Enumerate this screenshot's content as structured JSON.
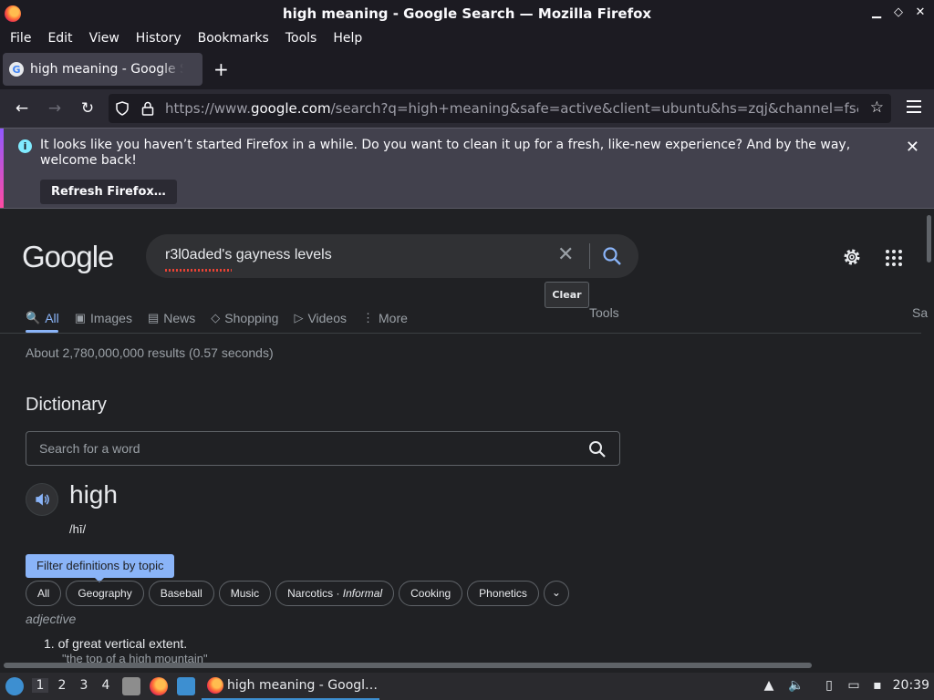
{
  "window": {
    "title": "high meaning - Google Search — Mozilla Firefox",
    "min": "▁",
    "max": "◇",
    "close": "✕"
  },
  "menu": [
    "File",
    "Edit",
    "View",
    "History",
    "Bookmarks",
    "Tools",
    "Help"
  ],
  "tab": {
    "label": "high meaning - Google Search",
    "favicon": "G",
    "close": "✕",
    "new": "+"
  },
  "nav": {
    "url_prefix": "https://www.",
    "url_domain": "google.com",
    "url_rest": "/search?q=high+meaning&safe=active&client=ubuntu&hs=zqj&channel=fs&ei=Ge",
    "star": "☆"
  },
  "notification": {
    "message": "It looks like you haven’t started Firefox in a while. Do you want to clean it up for a fresh, like-new experience? And by the way, welcome back!",
    "button": "Refresh Firefox…",
    "close": "✕",
    "info": "i"
  },
  "google": {
    "logo": "Google",
    "query": "r3l0aded's gayness levels",
    "clear_tooltip": "Clear",
    "tabs": [
      {
        "label": "All",
        "icon": "🔍"
      },
      {
        "label": "Images",
        "icon": "▣"
      },
      {
        "label": "News",
        "icon": "▤"
      },
      {
        "label": "Shopping",
        "icon": "◇"
      },
      {
        "label": "Videos",
        "icon": "▷"
      },
      {
        "label": "More",
        "icon": "⋮"
      }
    ],
    "tools": "Tools",
    "safe": "Sa",
    "stats": "About 2,780,000,000 results (0.57 seconds)"
  },
  "dictionary": {
    "heading": "Dictionary",
    "search_placeholder": "Search for a word",
    "word": "high",
    "phonetic": "/hī/",
    "filter_tip": "Filter definitions by topic",
    "chips": [
      "All",
      "Geography",
      "Baseball",
      "Music",
      "Narcotics",
      "Cooking",
      "Phonetics"
    ],
    "chip_informal": "Informal",
    "part_of_speech": "adjective",
    "definition": "1.  of great vertical extent.",
    "example": "\"the top of a high mountain\""
  },
  "taskbar": {
    "workspaces": [
      "1",
      "2",
      "3",
      "4"
    ],
    "task_label": "high meaning - Googl…",
    "clock": "20:39"
  },
  "colors": {
    "accent": "#8ab4f8",
    "page_bg": "#202124",
    "chrome_bg": "#1c1b22"
  }
}
